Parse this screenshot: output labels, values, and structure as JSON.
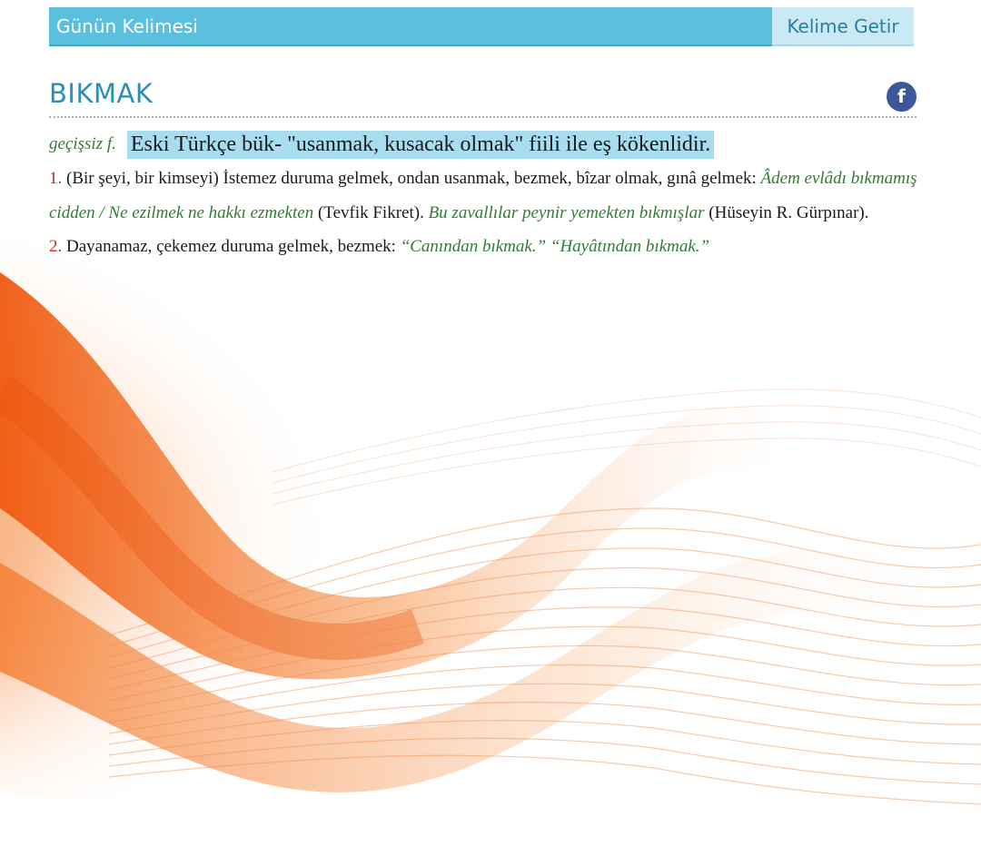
{
  "header": {
    "title": "Günün Kelimesi",
    "fetch_button": "Kelime Getir"
  },
  "entry": {
    "word": "BIKMAK",
    "share_icon_letter": "f",
    "grammar": "geçişsiz f.",
    "etymology": "Eski Türkçe bük- \"usanmak, kusacak olmak\" fiili ile eş kökenlidir.",
    "senses": [
      {
        "number": "1.",
        "definition": " (Bir şeyi, bir kimseyi) İstemez duruma gelmek, ondan usanmak, bezmek, bîzar olmak, gınâ gelmek: ",
        "example1": "Âdem evlâdı bıkmamış cidden / Ne ezilmek ne hakkı ezmekten",
        "source1": " (Tevfik Fikret). ",
        "example2": "Bu zavallılar peynir yemekten bıkmışlar",
        "source2": " (Hüseyin R. Gürpınar)."
      },
      {
        "number": "2.",
        "definition": " Dayanamaz, çekemez duruma gelmek, bezmek: ",
        "example1": "“Canından bıkmak.”",
        "separator": " ",
        "example2": "“Hayâtından bıkmak.”"
      }
    ]
  },
  "colors": {
    "header_bg": "#5bc0de",
    "button_bg": "#c9e9f4",
    "word_title": "#2a8fb3",
    "facebook": "#3b5998",
    "example_text": "#2e7d32",
    "sense_number": "#c62828",
    "etymology_highlight": "#a8dcef",
    "background_wave": "#f26a1b"
  },
  "icons": {
    "share": "facebook-icon"
  }
}
